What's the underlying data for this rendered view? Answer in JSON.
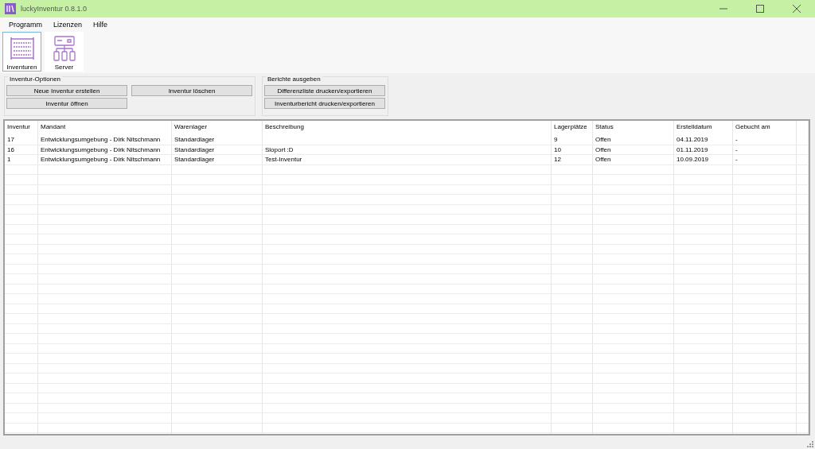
{
  "window": {
    "title": "luckyInventur 0.8.1.0"
  },
  "menu": [
    "Programm",
    "Lizenzen",
    "Hilfe"
  ],
  "toolbar": [
    {
      "label": "Inventuren",
      "kind": "abacus",
      "selected": true
    },
    {
      "label": "Server",
      "kind": "server",
      "selected": false
    }
  ],
  "groups": [
    {
      "title": "Inventur-Optionen",
      "buttons": [
        "Neue Inventur erstellen",
        "Inventur löschen",
        "Inventur öffnen"
      ]
    },
    {
      "title": "Berichte ausgeben",
      "buttons": [
        "Differenzliste drucken/exportieren",
        "Inventurbericht drucken/exportieren"
      ]
    }
  ],
  "table": {
    "columns": [
      "Inventur",
      "Mandant",
      "Warenlager",
      "Beschreibung",
      "Lagerplätze",
      "Status",
      "Erstelldatum",
      "Gebucht am"
    ],
    "rows": [
      [
        "17",
        "Entwicklungsumgebung - Dirk Nitschmann",
        "Standardlager",
        "",
        "9",
        "Offen",
        "04.11.2019",
        "-"
      ],
      [
        "16",
        "Entwicklungsumgebung - Dirk Nitschmann",
        "Standardlager",
        "Sloport :D",
        "10",
        "Offen",
        "01.11.2019",
        "-"
      ],
      [
        "1",
        "Entwicklungsumgebung - Dirk Nitschmann",
        "Standardlager",
        "Test-Inventur",
        "12",
        "Offen",
        "10.09.2019",
        "-"
      ]
    ]
  }
}
